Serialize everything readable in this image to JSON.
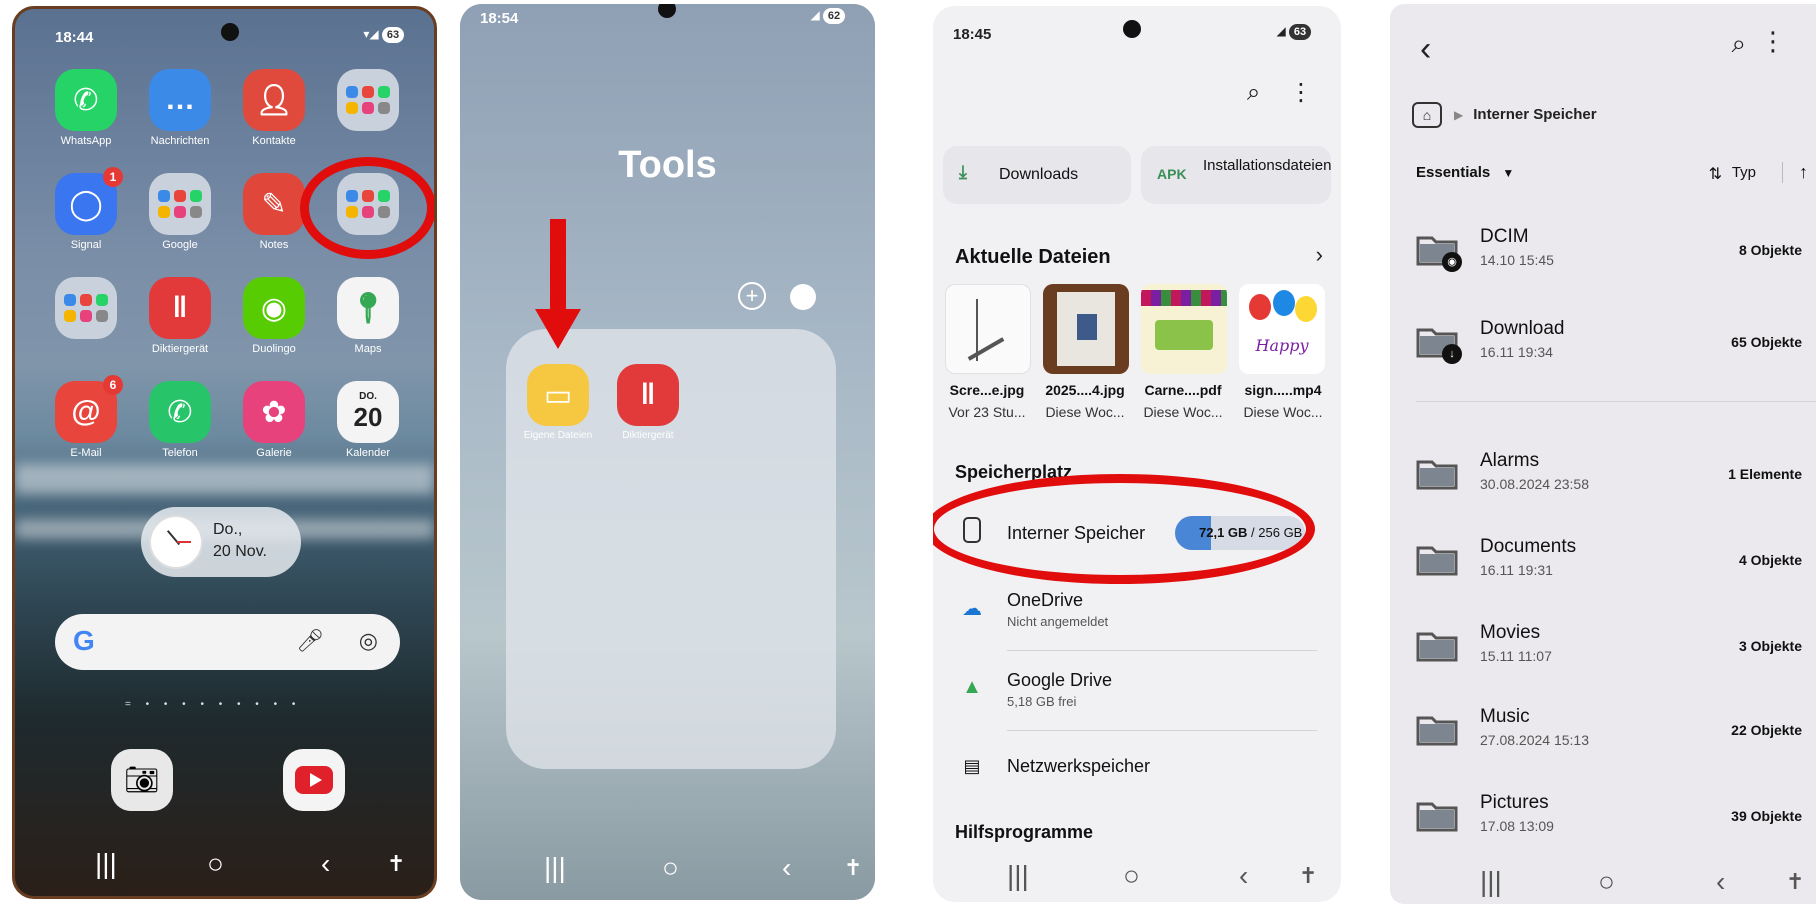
{
  "colors": {
    "highlight_red": "#e10d0d",
    "accent_blue": "#4a86d6"
  },
  "panel1": {
    "status": {
      "time": "18:44",
      "battery": "63"
    },
    "apps": [
      {
        "label": "WhatsApp",
        "icon": "whatsapp-icon",
        "color": "#25d366"
      },
      {
        "label": "Nachrichten",
        "icon": "messages-icon",
        "color": "#3c8ae8"
      },
      {
        "label": "Kontakte",
        "icon": "contacts-icon",
        "color": "#e04a3c"
      },
      {
        "label": "",
        "icon": "folder-icon",
        "color": "#c9d2dc"
      },
      {
        "label": "Signal",
        "icon": "signal-icon",
        "color": "#3a76f0",
        "badge": "1"
      },
      {
        "label": "Google",
        "icon": "folder-icon",
        "color": "#c9d2dc"
      },
      {
        "label": "Notes",
        "icon": "notes-icon",
        "color": "#e0463a"
      },
      {
        "label": "",
        "icon": "folder-icon",
        "color": "#c9d2dc"
      },
      {
        "label": "",
        "icon": "folder-icon",
        "color": "#c9d2dc"
      },
      {
        "label": "Diktiergerät",
        "icon": "voice-recorder-icon",
        "color": "#e23a3a"
      },
      {
        "label": "Duolingo",
        "icon": "duolingo-icon",
        "color": "#58cc02"
      },
      {
        "label": "Maps",
        "icon": "maps-icon",
        "color": "#f4f4f4"
      },
      {
        "label": "E-Mail",
        "icon": "email-icon",
        "color": "#e8453c",
        "badge": "6"
      },
      {
        "label": "Telefon",
        "icon": "phone-icon",
        "color": "#27c46a"
      },
      {
        "label": "Galerie",
        "icon": "gallery-icon",
        "color": "#e8427d"
      },
      {
        "label": "Kalender",
        "icon": "calendar-icon",
        "color": "#f4f4f4"
      }
    ],
    "calendar": {
      "day": "DO.",
      "date": "20"
    },
    "clock": {
      "line1": "Do.,",
      "line2": "20 Nov."
    },
    "search": {
      "g": "G"
    }
  },
  "panel2": {
    "status": {
      "time": "18:54",
      "battery": "62"
    },
    "folder_title": "Tools",
    "apps": [
      {
        "label": "Eigene Dateien",
        "icon": "my-files-icon",
        "color": "#f6c842"
      },
      {
        "label": "Diktiergerät",
        "icon": "voice-recorder-icon",
        "color": "#e23a3a"
      }
    ]
  },
  "panel3": {
    "status": {
      "time": "18:45",
      "battery": "63"
    },
    "quick": [
      {
        "label": "Downloads",
        "icon": "download-icon"
      },
      {
        "label": "Installationsdateien",
        "icon": "apk-icon",
        "icon_text": "APK"
      }
    ],
    "recent_title": "Aktuelle Dateien",
    "recent": [
      {
        "name": "Scre...e.jpg",
        "date": "Vor 23 Stu..."
      },
      {
        "name": "2025....4.jpg",
        "date": "Diese Woc..."
      },
      {
        "name": "Carne....pdf",
        "date": "Diese Woc..."
      },
      {
        "name": "sign.....mp4",
        "date": "Diese Woc..."
      }
    ],
    "storage_title": "Speicherplatz",
    "storage": [
      {
        "label": "Interner Speicher",
        "icon": "phone-storage-icon",
        "used": "72,1 GB",
        "total": "256 GB",
        "fill": 0.28
      },
      {
        "label": "OneDrive",
        "sub": "Nicht angemeldet",
        "icon": "onedrive-icon"
      },
      {
        "label": "Google Drive",
        "sub": "5,18 GB frei",
        "icon": "google-drive-icon"
      },
      {
        "label": "Netzwerkspeicher",
        "icon": "network-storage-icon"
      }
    ],
    "tools_title": "Hilfsprogramme"
  },
  "panel4": {
    "breadcrumb": "Interner Speicher",
    "filter": "Essentials",
    "sort": "Typ",
    "folders": [
      {
        "name": "DCIM",
        "date": "14.10 15:45",
        "count": "8 Objekte",
        "badge": "camera"
      },
      {
        "name": "Download",
        "date": "16.11 19:34",
        "count": "65 Objekte",
        "badge": "download"
      },
      {
        "name": "Alarms",
        "date": "30.08.2024 23:58",
        "count": "1 Elemente"
      },
      {
        "name": "Documents",
        "date": "16.11 19:31",
        "count": "4 Objekte"
      },
      {
        "name": "Movies",
        "date": "15.11 11:07",
        "count": "3 Objekte"
      },
      {
        "name": "Music",
        "date": "27.08.2024 15:13",
        "count": "22 Objekte"
      },
      {
        "name": "Pictures",
        "date": "17.08 13:09",
        "count": "39 Objekte"
      }
    ]
  }
}
